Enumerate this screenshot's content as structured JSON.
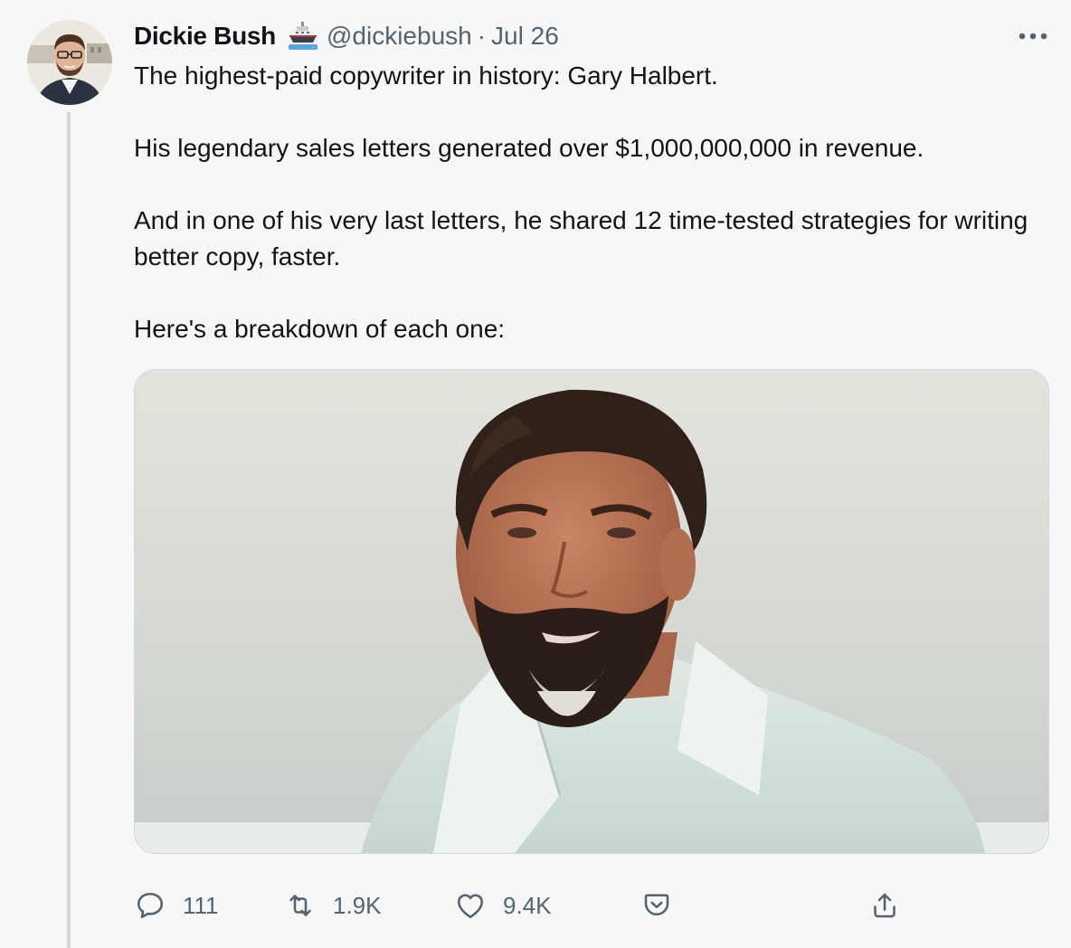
{
  "tweet": {
    "author_name": "Dickie Bush",
    "badge_icon": "ship-emoji-icon",
    "handle": "@dickiebush",
    "separator": "·",
    "date": "Jul 26",
    "paragraphs": [
      "The highest-paid copywriter in history: Gary Halbert.",
      "His legendary sales letters generated over $1,000,000,000 in revenue.",
      "And in one of his very last letters, he shared 12 time-tested strategies for writing better copy, faster.",
      "Here's a breakdown of each one:"
    ],
    "media_icon": "photo-of-bearded-man",
    "actions": {
      "reply_count": "111",
      "retweet_count": "1.9K",
      "like_count": "9.4K"
    }
  },
  "icons": {
    "more": "more-icon",
    "reply": "reply-icon",
    "retweet": "retweet-icon",
    "like": "heart-icon",
    "save": "save-icon",
    "share": "share-icon"
  },
  "colors": {
    "background": "#f7f7f7",
    "text_primary": "#0f1419",
    "text_secondary": "#536471",
    "thread_line": "#cfd9de"
  }
}
